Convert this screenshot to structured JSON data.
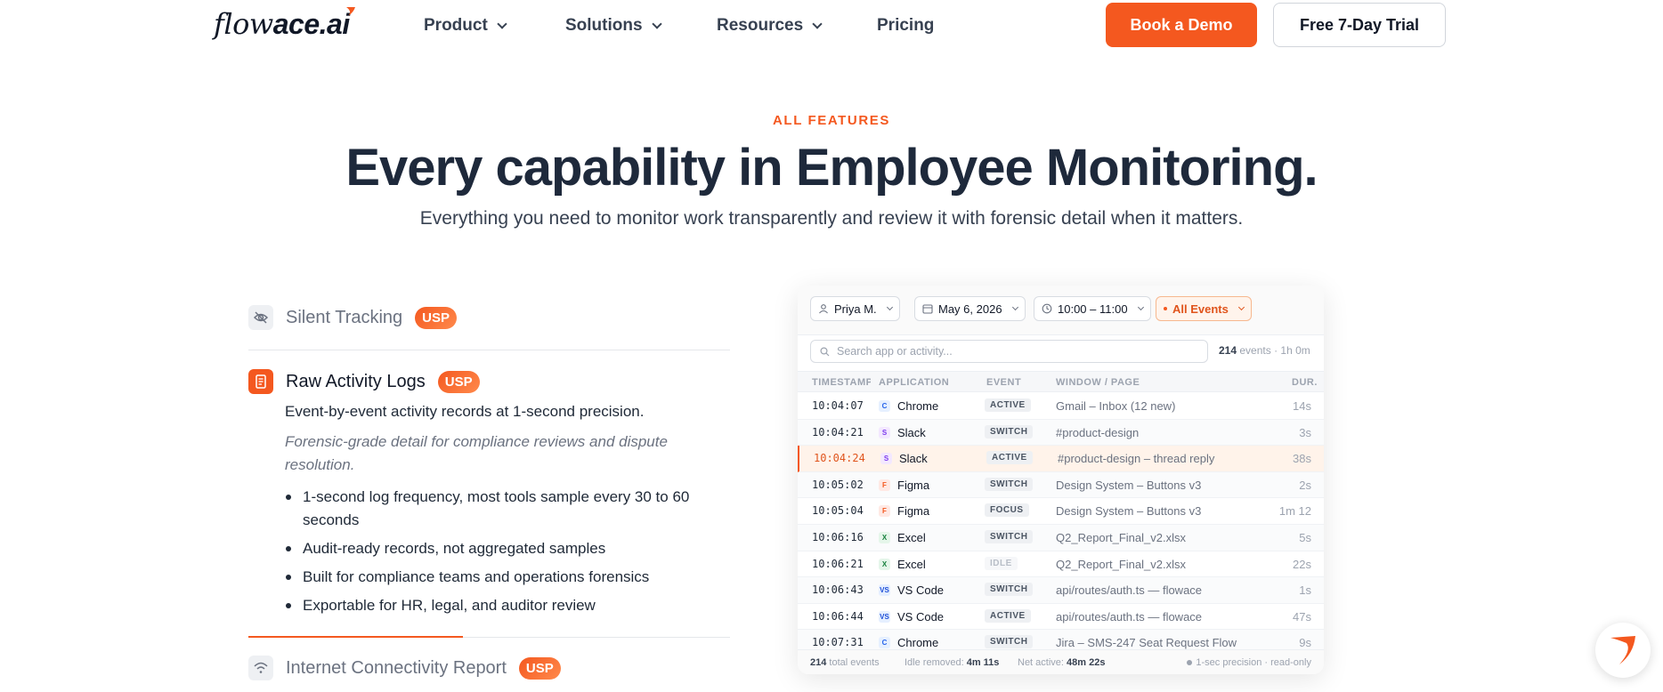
{
  "nav": {
    "logo_part1": "flow",
    "logo_part2": "ace.ai",
    "items": [
      {
        "label": "Product",
        "dropdown": true
      },
      {
        "label": "Solutions",
        "dropdown": true
      },
      {
        "label": "Resources",
        "dropdown": true
      },
      {
        "label": "Pricing",
        "dropdown": false
      }
    ],
    "cta_demo": "Book a Demo",
    "cta_trial": "Free 7-Day Trial"
  },
  "hero": {
    "eyebrow": "ALL FEATURES",
    "title": "Every capability in Employee Monitoring.",
    "subtitle": "Everything you need to monitor work transparently and review it with forensic detail when it matters."
  },
  "features": [
    {
      "title": "Silent Tracking",
      "badge": "USP",
      "icon": "eye-off-icon",
      "active": false
    },
    {
      "title": "Raw Activity Logs",
      "badge": "USP",
      "icon": "document-icon",
      "active": true
    },
    {
      "title": "Internet Connectivity Report",
      "badge": "USP",
      "icon": "wifi-icon",
      "active": false
    }
  ],
  "active_feature": {
    "description": "Event-by-event activity records at 1-second precision.",
    "note": "Forensic-grade detail for compliance reviews and dispute resolution.",
    "bullets": [
      "1-second log frequency, most tools sample every 30 to 60 seconds",
      "Audit-ready records, not aggregated samples",
      "Built for compliance teams and operations forensics",
      "Exportable for HR, legal, and auditor review"
    ]
  },
  "log_panel": {
    "filters": {
      "user": "Priya M.",
      "date": "May 6, 2026",
      "time": "10:00 – 11:00",
      "events": "All Events"
    },
    "search_placeholder": "Search app or activity...",
    "event_count": "214",
    "event_count_suffix": "events · 1h 0m",
    "columns": [
      "TIMESTAMP",
      "APPLICATION",
      "EVENT",
      "WINDOW / PAGE",
      "DUR."
    ],
    "rows": [
      {
        "ts": "10:04:07",
        "badge": "C",
        "app": "Chrome",
        "event": "ACTIVE",
        "window": "Gmail – Inbox (12 new)",
        "dur": "14s"
      },
      {
        "ts": "10:04:21",
        "badge": "S",
        "app": "Slack",
        "event": "SWITCH",
        "window": "#product-design",
        "dur": "3s"
      },
      {
        "ts": "10:04:24",
        "badge": "S",
        "app": "Slack",
        "event": "ACTIVE",
        "window": "#product-design – thread reply",
        "dur": "38s"
      },
      {
        "ts": "10:05:02",
        "badge": "F",
        "app": "Figma",
        "event": "SWITCH",
        "window": "Design System – Buttons v3",
        "dur": "2s"
      },
      {
        "ts": "10:05:04",
        "badge": "F",
        "app": "Figma",
        "event": "FOCUS",
        "window": "Design System – Buttons v3",
        "dur": "1m 12"
      },
      {
        "ts": "10:06:16",
        "badge": "X",
        "app": "Excel",
        "event": "SWITCH",
        "window": "Q2_Report_Final_v2.xlsx",
        "dur": "5s"
      },
      {
        "ts": "10:06:21",
        "badge": "X",
        "app": "Excel",
        "event": "IDLE",
        "window": "Q2_Report_Final_v2.xlsx",
        "dur": "22s"
      },
      {
        "ts": "10:06:43",
        "badge": "VS",
        "app": "VS Code",
        "event": "SWITCH",
        "window": "api/routes/auth.ts — flowace",
        "dur": "1s"
      },
      {
        "ts": "10:06:44",
        "badge": "VS",
        "app": "VS Code",
        "event": "ACTIVE",
        "window": "api/routes/auth.ts — flowace",
        "dur": "47s"
      },
      {
        "ts": "10:07:31",
        "badge": "C",
        "app": "Chrome",
        "event": "SWITCH",
        "window": "Jira – SMS-247 Seat Request Flow",
        "dur": "9s"
      }
    ],
    "footer": {
      "total": "214",
      "total_label": "total events",
      "idle_label": "Idle removed:",
      "idle_value": "4m 11s",
      "net_label": "Net active:",
      "net_value": "48m 22s",
      "precision": "1-sec precision · read-only"
    }
  },
  "colors": {
    "accent": "#f4581f",
    "heading": "#1e293b",
    "muted": "#6b7280"
  }
}
